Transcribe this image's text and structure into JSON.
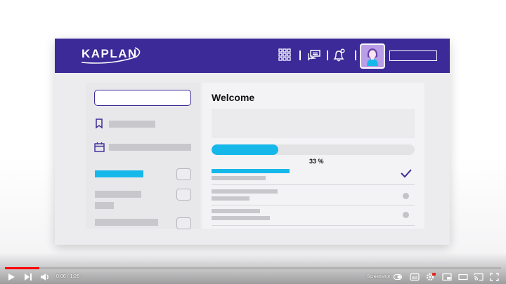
{
  "brand": {
    "logo_text": "KAPLAN",
    "color": "#3c2a98",
    "accent": "#16b8ea"
  },
  "topbar": {
    "icons": [
      "apps-grid-icon",
      "chat-icon",
      "notification-bell-icon"
    ],
    "user_name": ""
  },
  "sidebar": {
    "search": {
      "value": "",
      "placeholder": ""
    },
    "items": [
      {
        "icon": "bookmark-icon",
        "label": ""
      },
      {
        "icon": "calendar-icon",
        "label": ""
      }
    ]
  },
  "main": {
    "title": "Welcome",
    "progress": {
      "value": 33,
      "label": "33 %"
    }
  },
  "player": {
    "time": "0:06 / 1:26",
    "played_fraction": 0.07,
    "screenshot_label": "Screenshot"
  }
}
